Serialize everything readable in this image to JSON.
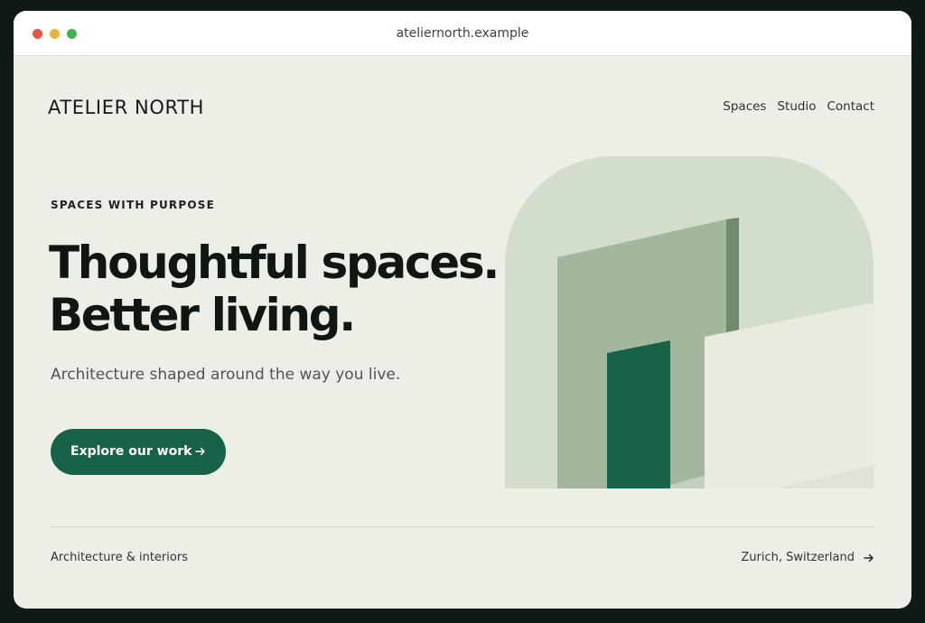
{
  "browser": {
    "url": "ateliernorth.example"
  },
  "header": {
    "logo": "ATELIER NORTH",
    "nav": [
      "Spaces",
      "Studio",
      "Contact"
    ]
  },
  "hero": {
    "eyebrow": "SPACES WITH PURPOSE",
    "headline_line1": "Thoughtful spaces.",
    "headline_line2": "Better living.",
    "subtext": "Architecture shaped around the way you live.",
    "cta_label": "Explore our work",
    "cta_icon": "arrow-right-icon"
  },
  "footer": {
    "left": "Architecture & interiors",
    "right": "Zurich, Switzerland",
    "right_icon": "arrow-right-icon"
  },
  "colors": {
    "accent": "#17634a",
    "background": "#ecefe6",
    "arch": "#d3ddcb",
    "wall": "#a3b79f",
    "wall_edge": "#6f8a6e",
    "panel": "#e9ebdf",
    "door": "#17634a"
  }
}
